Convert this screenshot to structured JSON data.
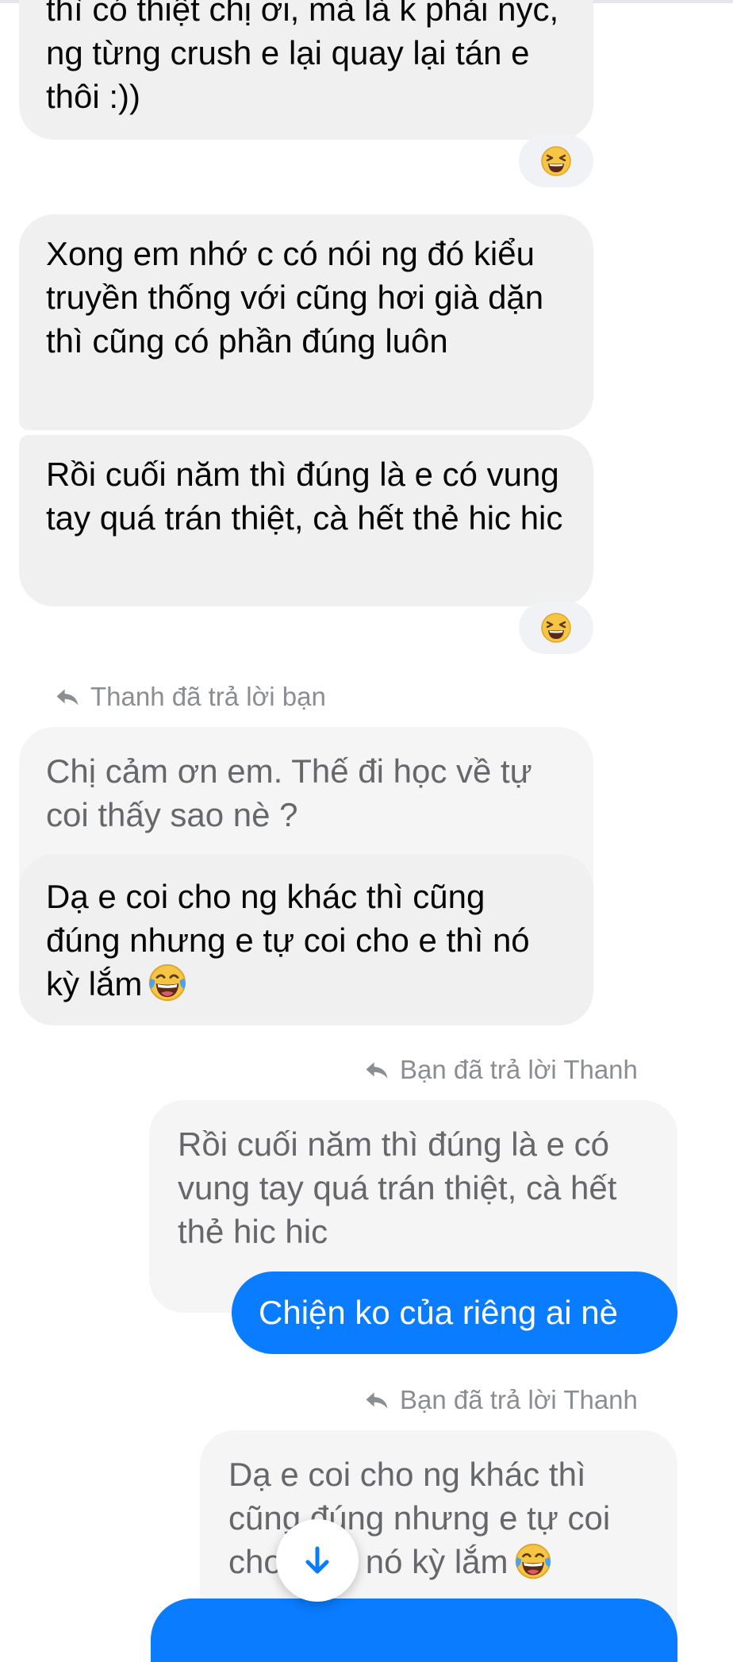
{
  "messages": {
    "m1": "thì có thiệt chị ơi, mà là k phải nyc, ng từng crush e lại quay lại tán e thôi :))",
    "m2": "Xong em nhớ c có nói ng đó kiểu truyền thống với cũng hơi già dặn thì cũng có phần đúng luôn",
    "m3": "Rồi cuối năm thì đúng là e có vung tay quá trán thiệt, cà hết thẻ hic hic",
    "reply_label_1": "Thanh đã trả lời bạn",
    "quote_1": "Chị cảm ơn em. Thế đi học về tự coi thấy sao nè ?",
    "m4": "Dạ e coi cho ng khác thì cũng đúng nhưng e tự coi cho e thì nó kỳ lắm",
    "reply_label_2": "Bạn đã trả lời Thanh",
    "quote_2": "Rồi cuối năm thì đúng là e có vung tay quá trán thiệt, cà hết thẻ hic hic",
    "m5": "Chiện ko của riêng ai nè",
    "reply_label_3": "Bạn đã trả lời Thanh",
    "quote_3": "Dạ e coi cho ng khác thì cũng đúng nhưng e tự coi cho e thì nó kỳ lắm"
  },
  "reactions": [
    "laughing-emoji",
    "laughing-emoji"
  ],
  "icons": {
    "reply": "reply-arrow-icon",
    "scroll": "arrow-down-icon",
    "emoji": "tears-of-joy-emoji"
  },
  "colors": {
    "incoming_bubble": "#f0f0f0",
    "outgoing_bubble": "#0a7cff",
    "quoted_bubble": "#f5f5f5",
    "meta_text": "#8a8d91"
  }
}
